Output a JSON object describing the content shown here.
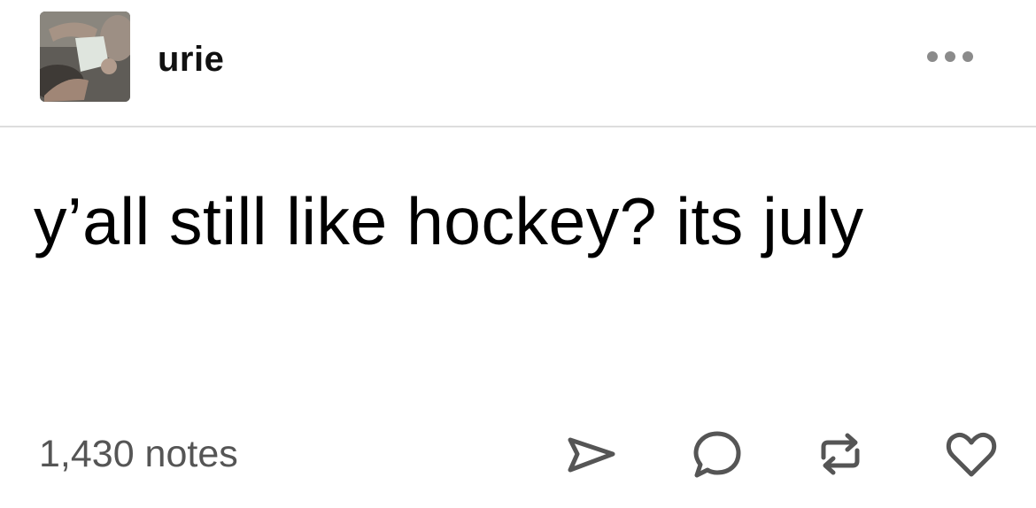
{
  "post": {
    "username": "urie",
    "text": "y’all still like hockey? its july",
    "notes_label": "1,430 notes"
  },
  "icons": {
    "more": "more-dots-icon",
    "share": "paper-plane-share-icon",
    "reply": "speech-bubble-reply-icon",
    "reblog": "reblog-arrows-icon",
    "like": "heart-like-icon"
  },
  "colors": {
    "text": "#000000",
    "muted": "#555555",
    "icon": "#555555",
    "divider": "#dddddd"
  }
}
